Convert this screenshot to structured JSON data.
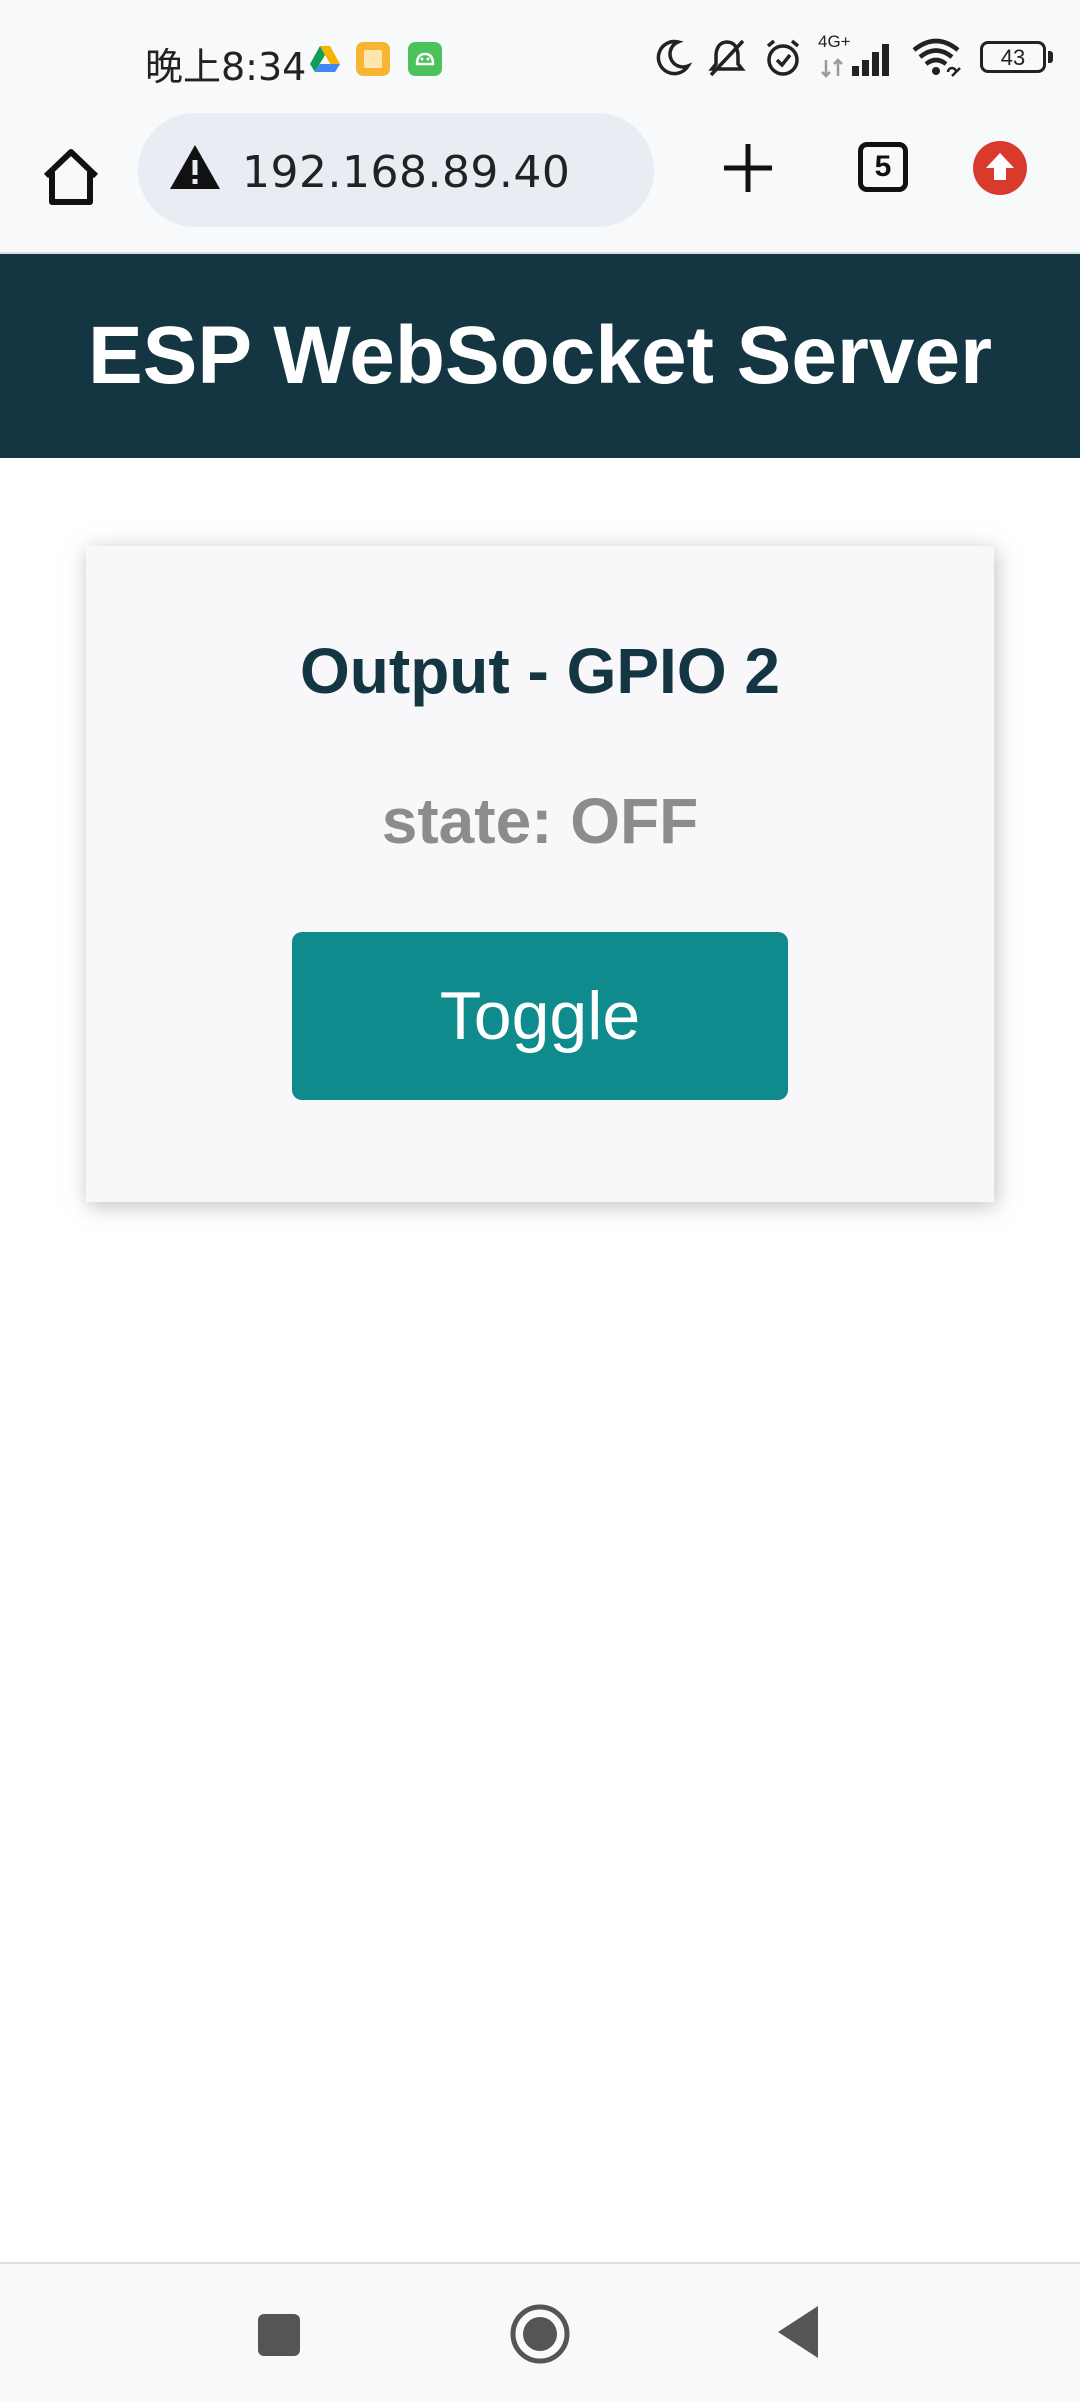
{
  "status_bar": {
    "time": "晚上8:34",
    "network": "4G+",
    "battery": "43"
  },
  "browser": {
    "url": "192.168.89.40",
    "tab_count": "5"
  },
  "page": {
    "title": "ESP WebSocket Server",
    "card": {
      "title": "Output - GPIO 2",
      "state_text": "state: OFF",
      "button_label": "Toggle"
    }
  },
  "colors": {
    "header_bg": "#143642",
    "button_bg": "#0f8b8d",
    "title_color": "#143642",
    "state_color": "#8c8c8c",
    "update_icon": "#d93a2b"
  },
  "icons": [
    "drive-icon",
    "notes-app-icon",
    "android-app-icon",
    "moon-icon",
    "bell-off-icon",
    "alarm-icon",
    "signal-icon",
    "wifi-icon",
    "battery-icon",
    "home-icon",
    "warning-icon",
    "plus-icon",
    "tabs-icon",
    "update-icon"
  ]
}
